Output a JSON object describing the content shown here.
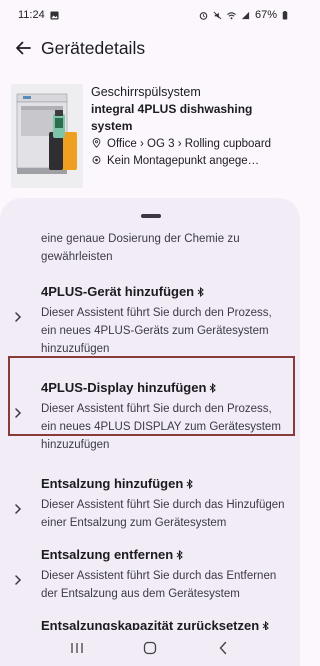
{
  "status_bar": {
    "time": "11:24",
    "battery": "67%",
    "icons": [
      "image-icon",
      "alarm-icon",
      "mute-icon",
      "wifi-icon",
      "signal-icon",
      "battery-icon"
    ]
  },
  "app_bar": {
    "title": "Gerätedetails",
    "back_icon": "back-arrow-icon"
  },
  "device": {
    "name": "Geschirrspülsystem",
    "model": "integral 4PLUS dishwashing system",
    "location": "Office › OG 3 › Rolling cupboard",
    "mounting": "Kein Montagepunkt angege…",
    "location_icon": "location-pin-icon",
    "mounting_icon": "target-icon"
  },
  "sheet": {
    "partial_text": "eine genaue Dosierung der Chemie zu gewährleisten",
    "items": [
      {
        "title": "4PLUS-Gerät hinzufügen",
        "desc": "Dieser Assistent führt Sie durch den Prozess, ein neues 4PLUS-Geräts zum Gerätesystem hinzuzufügen",
        "highlighted": false
      },
      {
        "title": "4PLUS-Display hinzufügen",
        "desc": "Dieser Assistent führt Sie durch den Prozess, ein neues 4PLUS DISPLAY zum Gerätesystem hinzuzufügen",
        "highlighted": true
      },
      {
        "title": "Entsalzung hinzufügen",
        "desc": "Dieser Assistent führt Sie durch das Hinzufügen einer Entsalzung zum Gerätesystem",
        "highlighted": false
      },
      {
        "title": "Entsalzung entfernen",
        "desc": "Dieser Assistent führt Sie durch das Entfernen der Entsalzung aus dem Gerätesystem",
        "highlighted": false
      },
      {
        "title": "Entsalzungskapazität zurücksetzen",
        "desc": "",
        "highlighted": false
      }
    ],
    "chevron_icon": "chevron-right-icon",
    "bluetooth_icon": "bluetooth-icon",
    "highlight_color": "#8b3a3a"
  },
  "nav_bar": {
    "buttons": [
      "recent-apps-icon",
      "home-icon",
      "back-icon"
    ]
  }
}
